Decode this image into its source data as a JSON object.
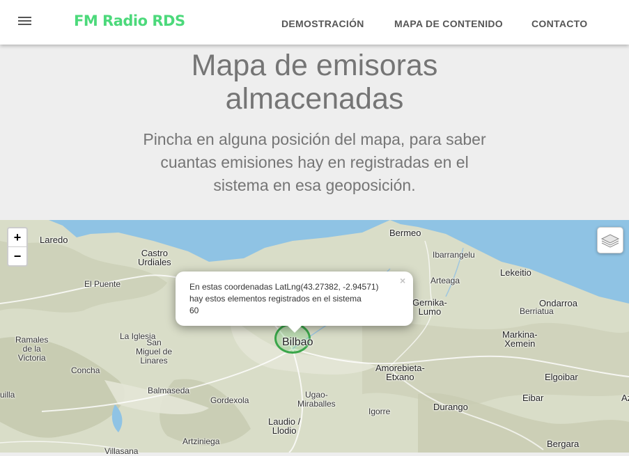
{
  "navbar": {
    "brand": "FM Radio RDS",
    "links": [
      "DEMOSTRACIÓN",
      "MAPA DE CONTENIDO",
      "CONTACTO"
    ]
  },
  "header": {
    "title_lines": [
      "Mapa de emisoras",
      "almacenadas"
    ],
    "subtitle_lines": [
      "Pincha en alguna posición del mapa, para saber",
      "cuantas emisiones hay en registradas en el",
      "sistema en esa geoposición."
    ]
  },
  "map": {
    "zoom_in": "+",
    "zoom_out": "−",
    "popup": {
      "lines": [
        "En estas coordenadas LatLng(43.27382, -2.94571)",
        "hay estos elementos registrados en el sistema",
        "60"
      ],
      "close": "×"
    },
    "places": {
      "laredo": "Laredo",
      "castro": [
        "Castro",
        "Urdiales"
      ],
      "elpuente": "El Puente",
      "bermeo": "Bermeo",
      "ibarrangelu": "Ibarrangelu",
      "lekeitio": "Lekeitio",
      "arteaga": "Arteaga",
      "gernika": [
        "Gernika-",
        "Lumo"
      ],
      "ondarroa": "Ondarroa",
      "berriatua": "Berriatua",
      "markina": [
        "Markina-",
        "Xemein"
      ],
      "ramales": [
        "Ramales",
        "de la",
        "Victoria"
      ],
      "laiglesia": "La Iglesia",
      "sanmiguel": [
        "San",
        "Miguel de",
        "Linares"
      ],
      "concha": "Concha",
      "bilbao": "Bilbao",
      "amorebieta": [
        "Amorebieta-",
        "Etxano"
      ],
      "elgoibar": "Elgoibar",
      "balmaseda": "Balmaseda",
      "gordexola": "Gordexola",
      "ugao": [
        "Ugao-",
        "Miraballes"
      ],
      "durango": "Durango",
      "eibar": "Eibar",
      "igorre": "Igorre",
      "laudio": [
        "Laudio /",
        "Llodio"
      ],
      "artziniega": "Artziniega",
      "bergara": "Bergara",
      "uilla": "uilla",
      "villasana": "Villasana",
      "az": "Az"
    },
    "colors": {
      "sea": "#8fc3e4",
      "terrain": "#d9ddc8",
      "marker": "#3aa64a",
      "brand": "#4cd97b"
    }
  }
}
